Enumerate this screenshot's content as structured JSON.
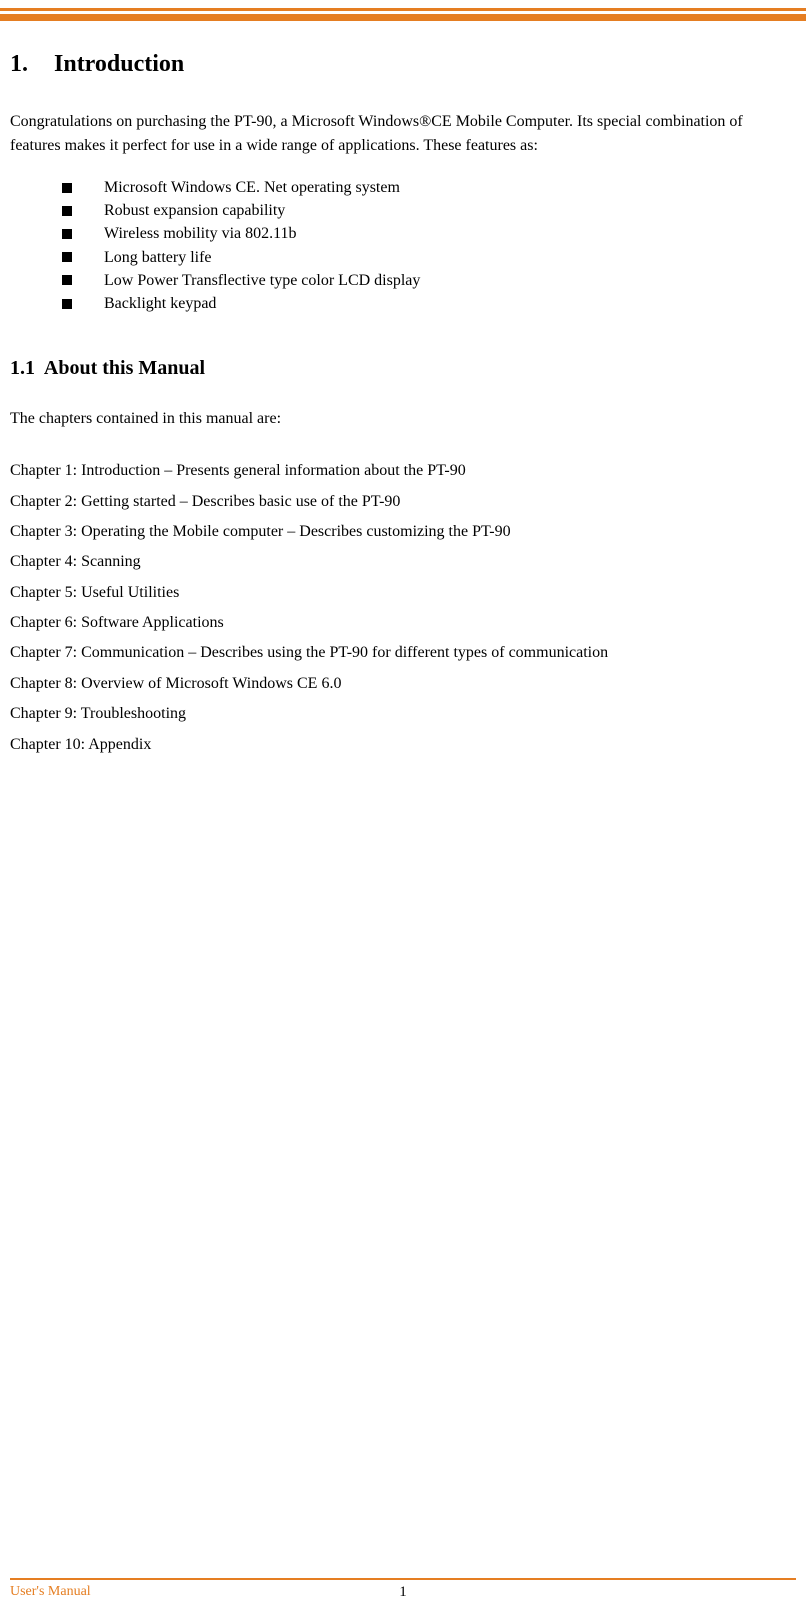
{
  "section1": {
    "number": "1.",
    "title": "Introduction",
    "intro": "Congratulations on purchasing the PT-90, a Microsoft Windows®CE Mobile Computer. Its special combination of features makes it perfect for use in a wide range of applications. These features as:",
    "features": [
      "Microsoft Windows CE. Net operating system",
      "Robust expansion capability",
      "Wireless mobility via 802.11b",
      "Long battery life",
      "Low Power Transflective type color LCD display",
      "Backlight keypad"
    ]
  },
  "section1_1": {
    "number": "1.1",
    "title": "About this Manual",
    "intro": "The chapters contained in this manual are:",
    "chapters": [
      "Chapter 1: Introduction – Presents general information about the PT-90",
      "Chapter 2: Getting started – Describes basic use of the PT-90",
      "Chapter 3: Operating the Mobile computer – Describes customizing the PT-90",
      "Chapter 4: Scanning",
      "Chapter 5: Useful Utilities",
      "Chapter 6: Software Applications",
      "Chapter 7: Communication – Describes using the PT-90 for different types of communication",
      "Chapter 8: Overview of Microsoft Windows CE 6.0",
      "Chapter 9: Troubleshooting",
      "Chapter 10: Appendix"
    ]
  },
  "footer": {
    "left": "User's Manual",
    "page": "1"
  }
}
